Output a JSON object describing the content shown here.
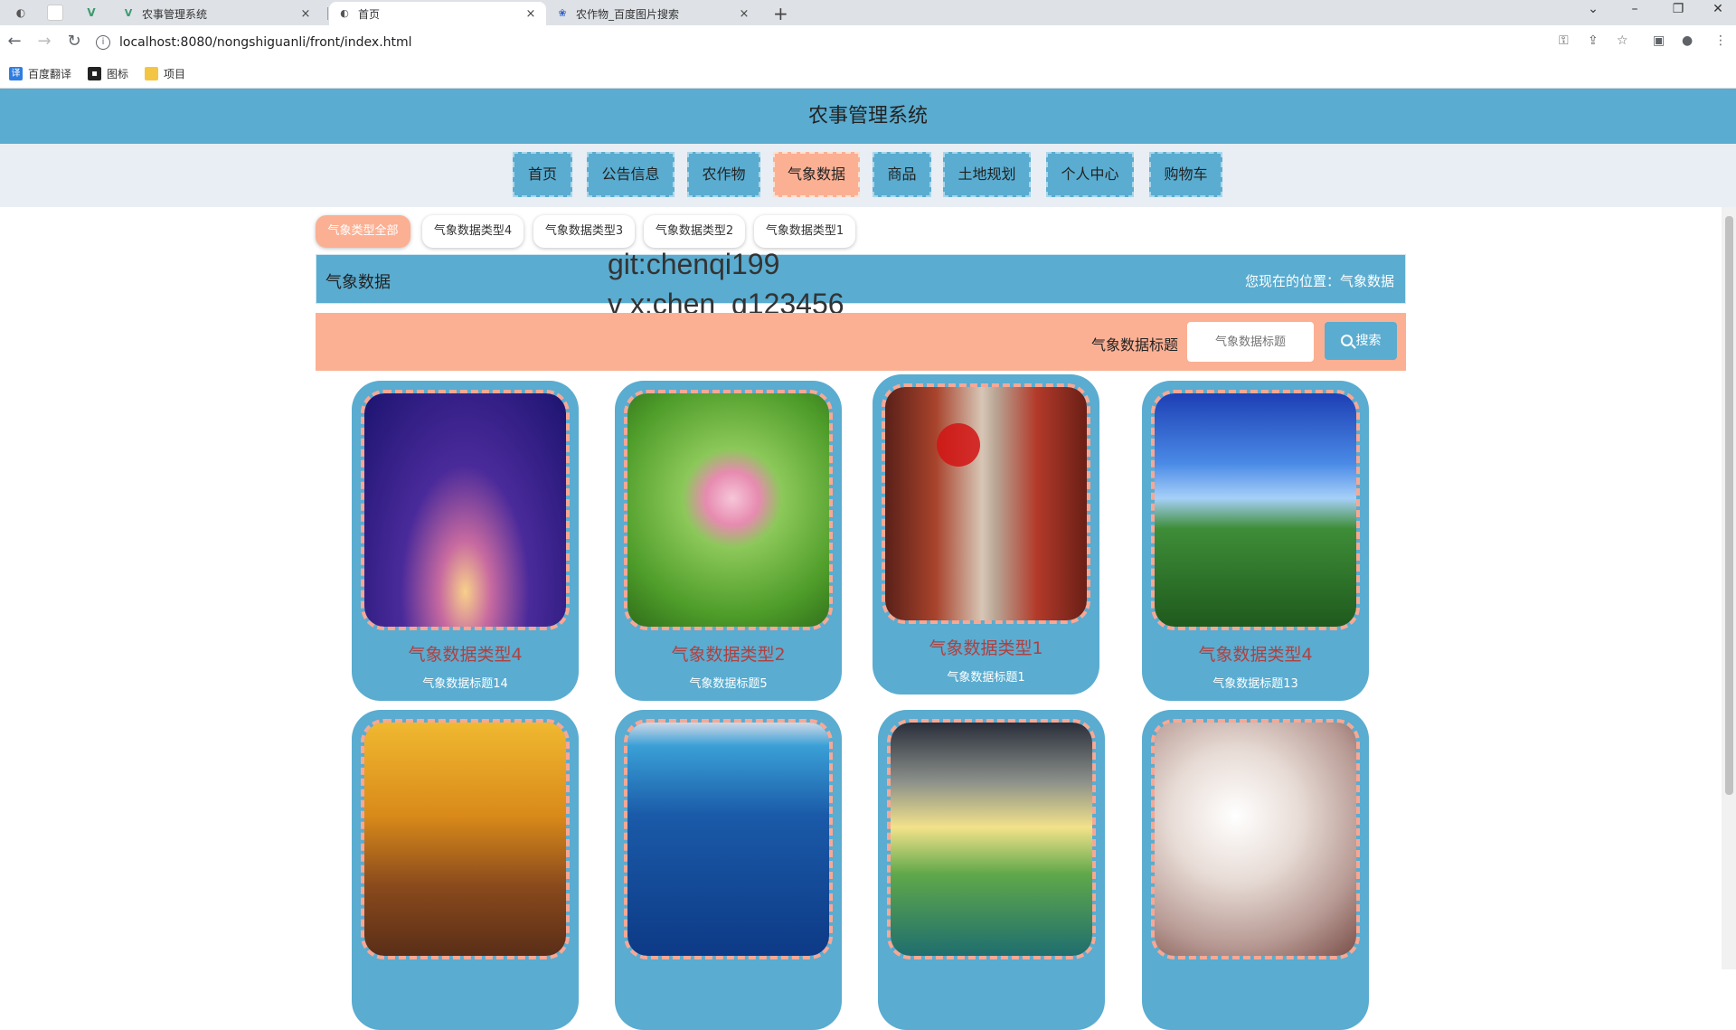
{
  "browser": {
    "tabs": [
      {
        "title": "农事管理系统",
        "close": "×"
      },
      {
        "title": "首页",
        "close": "×"
      },
      {
        "title": "农作物_百度图片搜索",
        "close": "×"
      }
    ],
    "new_tab": "+",
    "url": "localhost:8080/nongshiguanli/front/index.html",
    "bookmarks": [
      "百度翻译",
      "图标",
      "项目"
    ]
  },
  "site": {
    "title": "农事管理系统",
    "nav": [
      "首页",
      "公告信息",
      "农作物",
      "气象数据",
      "商品",
      "土地规划",
      "个人中心",
      "购物车"
    ],
    "active_nav": "气象数据"
  },
  "filters": [
    "气象类型全部",
    "气象数据类型4",
    "气象数据类型3",
    "气象数据类型2",
    "气象数据类型1"
  ],
  "breadcrumb": {
    "title": "气象数据",
    "location": "您现在的位置：气象数据"
  },
  "watermark": {
    "line1": "git:chenqi199",
    "line2": "v x:chen_q123456"
  },
  "search": {
    "label": "气象数据标题",
    "placeholder": "气象数据标题",
    "button": "搜索"
  },
  "cards": [
    {
      "type": "气象数据类型4",
      "title": "气象数据标题14",
      "image": "eiffel-tower-night"
    },
    {
      "type": "气象数据类型2",
      "title": "气象数据标题5",
      "image": "lotus-flower"
    },
    {
      "type": "气象数据类型1",
      "title": "气象数据标题1",
      "image": "red-corridor"
    },
    {
      "type": "气象数据类型4",
      "title": "气象数据标题13",
      "image": "meadow-moon-sky"
    },
    {
      "type": "",
      "title": "",
      "image": "autumn-tree-avenue"
    },
    {
      "type": "",
      "title": "",
      "image": "blue-lake-umbrella"
    },
    {
      "type": "",
      "title": "",
      "image": "sunset-lake"
    },
    {
      "type": "",
      "title": "",
      "image": "cherry-blossom"
    }
  ],
  "colors": {
    "primary": "#5aacd0",
    "accent": "#fbb094",
    "card_type_text": "#b04040"
  }
}
